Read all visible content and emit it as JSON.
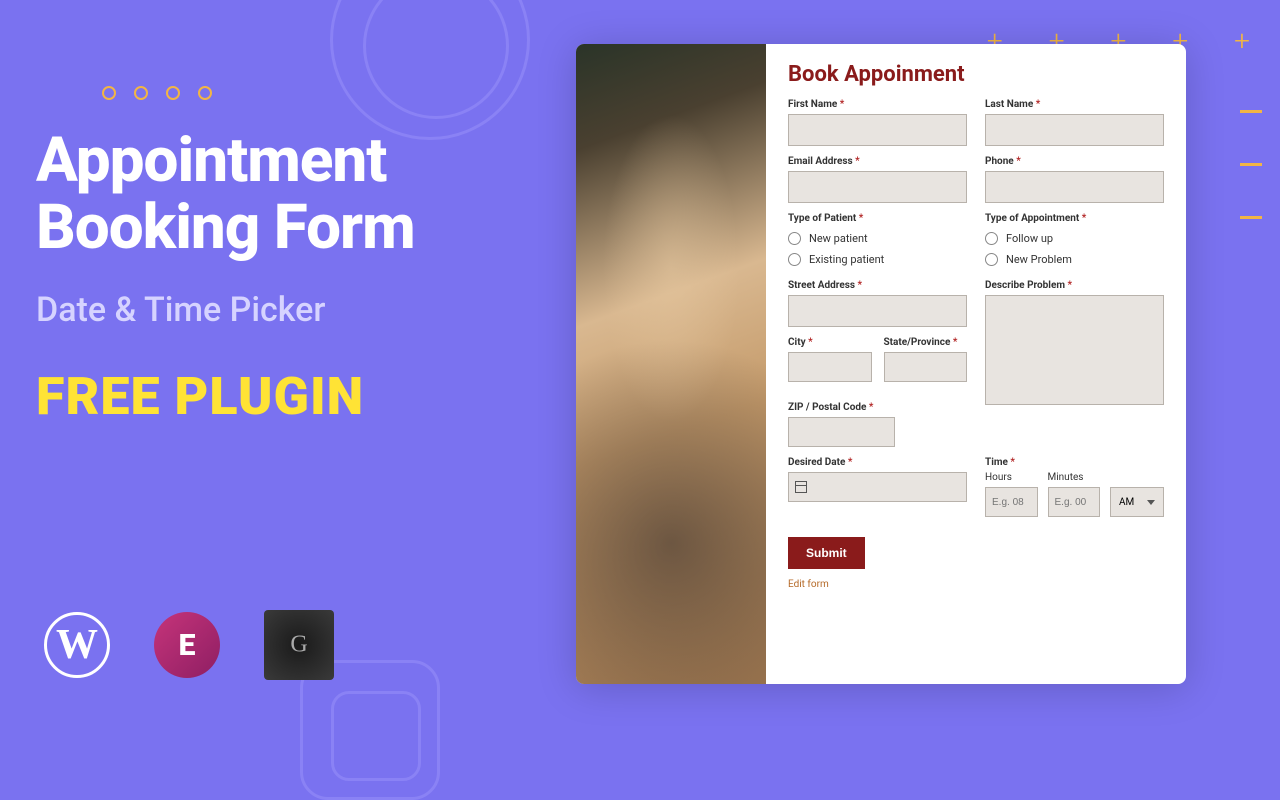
{
  "left": {
    "title_line1": "Appointment",
    "title_line2": "Booking Form",
    "subtitle": "Date & Time Picker",
    "free_plugin": "FREE PLUGIN"
  },
  "logos": {
    "wordpress": "W",
    "elementor": "E"
  },
  "form": {
    "title": "Book Appoinment",
    "first_name_label": "First Name",
    "last_name_label": "Last Name",
    "email_label": "Email Address",
    "phone_label": "Phone",
    "patient_type_label": "Type of Patient",
    "patient_type_options": [
      "New patient",
      "Existing patient"
    ],
    "appointment_type_label": "Type of Appointment",
    "appointment_type_options": [
      "Follow up",
      "New Problem"
    ],
    "street_label": "Street Address",
    "describe_label": "Describe Problem",
    "city_label": "City",
    "state_label": "State/Province",
    "zip_label": "ZIP / Postal Code",
    "date_label": "Desired Date",
    "time_label": "Time",
    "hours_label": "Hours",
    "minutes_label": "Minutes",
    "hours_placeholder": "E.g. 08",
    "minutes_placeholder": "E.g. 00",
    "ampm_value": "AM",
    "submit_label": "Submit",
    "edit_link": "Edit form"
  }
}
